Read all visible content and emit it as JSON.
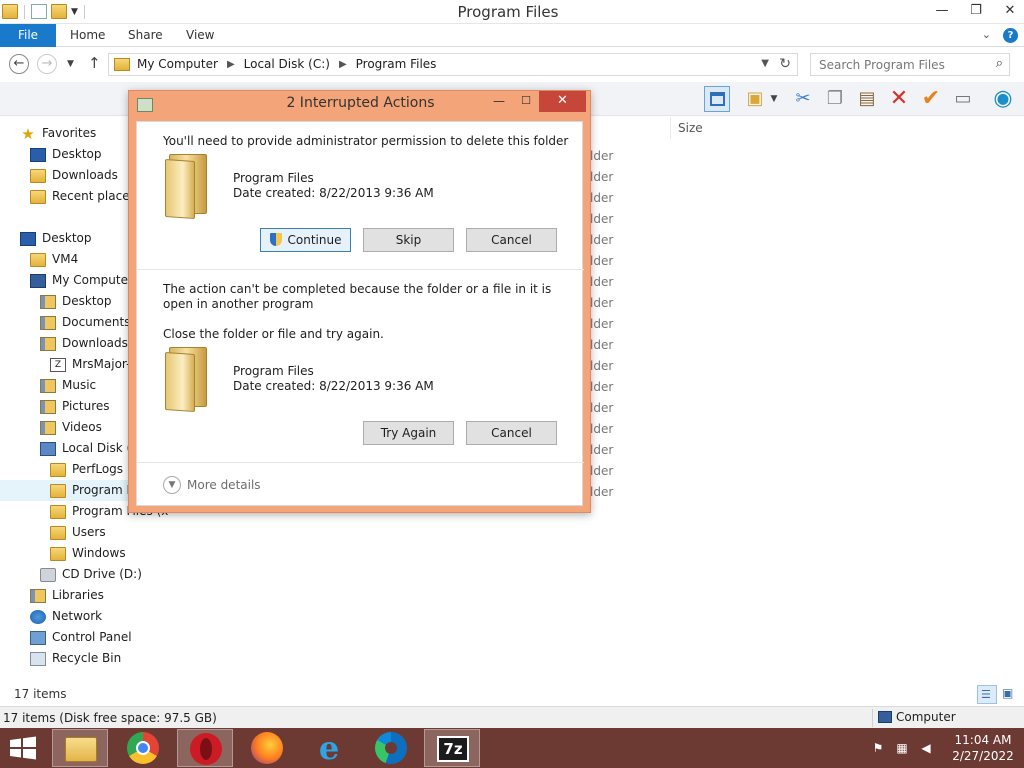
{
  "window": {
    "title": "Program Files",
    "minimize": "—",
    "maximize": "❐",
    "close": "✕"
  },
  "ribbon": {
    "tabs": [
      "File",
      "Home",
      "Share",
      "View"
    ],
    "expand_glyph": "⌄",
    "help_glyph": "?"
  },
  "address": {
    "crumbs": [
      "My Computer",
      "Local Disk (C:)",
      "Program Files"
    ],
    "search_placeholder": "Search Program Files"
  },
  "nav": {
    "items": [
      {
        "label": "Favorites",
        "icon": "star-icon"
      },
      {
        "label": "Desktop",
        "icon": "desktop-icon"
      },
      {
        "label": "Downloads",
        "icon": "folder-icon"
      },
      {
        "label": "Recent places",
        "icon": "folder-icon"
      },
      {
        "label": "Desktop",
        "icon": "desktop-icon"
      },
      {
        "label": "VM4",
        "icon": "folder-icon"
      },
      {
        "label": "My Computer",
        "icon": "computer-icon"
      },
      {
        "label": "Desktop",
        "icon": "library-folder-icon"
      },
      {
        "label": "Documents",
        "icon": "library-folder-icon"
      },
      {
        "label": "Downloads",
        "icon": "library-folder-icon"
      },
      {
        "label": "MrsMajor-",
        "icon": "file-icon"
      },
      {
        "label": "Music",
        "icon": "library-folder-icon"
      },
      {
        "label": "Pictures",
        "icon": "library-folder-icon"
      },
      {
        "label": "Videos",
        "icon": "library-folder-icon"
      },
      {
        "label": "Local Disk (C",
        "icon": "disk-icon"
      },
      {
        "label": "PerfLogs",
        "icon": "folder-icon"
      },
      {
        "label": "Program Fi",
        "icon": "folder-icon"
      },
      {
        "label": "Program Files (x",
        "icon": "folder-icon"
      },
      {
        "label": "Users",
        "icon": "folder-icon"
      },
      {
        "label": "Windows",
        "icon": "folder-icon"
      },
      {
        "label": "CD Drive (D:)",
        "icon": "cd-drive-icon"
      },
      {
        "label": "Libraries",
        "icon": "library-folder-icon"
      },
      {
        "label": "Network",
        "icon": "network-icon"
      },
      {
        "label": "Control Panel",
        "icon": "control-panel-icon"
      },
      {
        "label": "Recycle Bin",
        "icon": "recycle-bin-icon"
      }
    ]
  },
  "content": {
    "size_header": "Size",
    "type_fragment": "lder",
    "row_count": 17
  },
  "status": {
    "items_count": "17 items",
    "items_detail": "17 items (Disk free space: 97.5 GB)",
    "location": "Computer"
  },
  "dialog": {
    "title": "2 Interrupted Actions",
    "section1": {
      "message": "You'll need to provide administrator permission to delete this folder",
      "item_name": "Program Files",
      "item_date": "Date created: 8/22/2013 9:36 AM",
      "buttons": {
        "continue": "Continue",
        "skip": "Skip",
        "cancel": "Cancel"
      }
    },
    "section2": {
      "message": "The action can't be completed because the folder or a file in it is open in another program",
      "instruction": "Close the folder or file and try again.",
      "item_name": "Program Files",
      "item_date": "Date created: 8/22/2013 9:36 AM",
      "buttons": {
        "try_again": "Try Again",
        "cancel": "Cancel"
      }
    },
    "more_details": "More details"
  },
  "taskbar": {
    "apps": [
      "file-explorer-icon",
      "chrome-icon",
      "opera-icon",
      "firefox-icon",
      "internet-explorer-icon",
      "edge-icon",
      "7zip-icon"
    ],
    "sevenzip_label": "7z",
    "time": "11:04 AM",
    "date": "2/27/2022"
  },
  "colors": {
    "accent": "#1979ca",
    "dialog_frame": "#f3a478",
    "dialog_close": "#c7463a",
    "taskbar": "#6d3a33"
  }
}
